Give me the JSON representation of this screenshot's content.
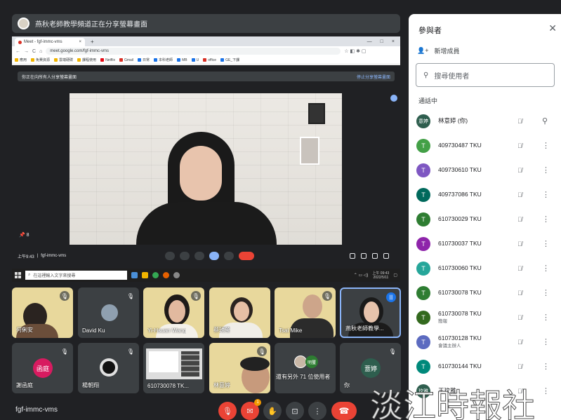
{
  "presenting_banner": "燕秋老師教學頻道正在分享螢幕畫面",
  "shared_screen": {
    "tab_title": "Meet - fgf-immc-vms",
    "tab_close": "×",
    "new_tab": "+",
    "window_controls": [
      "—",
      "□",
      "×"
    ],
    "url": "meet.google.com/fgf-immc-vms",
    "bookmarks": [
      "應用",
      "免費資源",
      "雲端硬碟",
      "課程使用",
      "Netflix",
      "Gmail",
      "日常",
      "本科老師",
      "MB",
      "U",
      "office",
      "GE_下課"
    ],
    "inner_banner": "你正在向所有人分享螢幕畫面",
    "inner_stop": "停止分享螢幕畫面",
    "inner_pin_count": "8",
    "inner_time": "上午9:43",
    "inner_code": "fgf-immc-vms",
    "taskbar_search": "在這裡輸入文字來搜尋",
    "taskbar_time": "上午 09:43",
    "taskbar_date": "2022/5/11"
  },
  "tiles": [
    {
      "name": "何俐安"
    },
    {
      "name": "David Ku"
    },
    {
      "name": "Yi-Hsuan Wang"
    },
    {
      "name": "蔡琇瑩"
    },
    {
      "name": "Tsai Mike"
    },
    {
      "name": "燕秋老師教學..."
    },
    {
      "name": "謝函庭",
      "avatar": "函庭"
    },
    {
      "name": "楊朝翔"
    },
    {
      "name": "610730078 TK..."
    },
    {
      "name": "林意婷"
    },
    {
      "name": "還有另外 71 位使用者",
      "avatar": "明璽"
    },
    {
      "name": "你",
      "avatar": "薏婷"
    }
  ],
  "bottom": {
    "meeting_code": "fgf-immc-vms",
    "notification_count": "1"
  },
  "panel": {
    "title": "參與者",
    "add_people": "新增成員",
    "search_placeholder": "搜尋使用者",
    "section": "通話中",
    "people": [
      {
        "name": "林意婷 (你)",
        "avatar": "意婷",
        "color": "#2e5e4e",
        "sub": ""
      },
      {
        "name": "409730487 TKU",
        "avatar": "T",
        "color": "#43a047",
        "sub": ""
      },
      {
        "name": "409730610 TKU",
        "avatar": "T",
        "color": "#7e57c2",
        "sub": ""
      },
      {
        "name": "409737086 TKU",
        "avatar": "T",
        "color": "#00695c",
        "sub": ""
      },
      {
        "name": "610730029 TKU",
        "avatar": "T",
        "color": "#2e7d32",
        "sub": ""
      },
      {
        "name": "610730037 TKU",
        "avatar": "T",
        "color": "#8e24aa",
        "sub": ""
      },
      {
        "name": "610730060 TKU",
        "avatar": "T",
        "color": "#26a69a",
        "sub": ""
      },
      {
        "name": "610730078 TKU",
        "avatar": "T",
        "color": "#2e7d32",
        "sub": ""
      },
      {
        "name": "610730078 TKU",
        "avatar": "T",
        "color": "#33691e",
        "sub": "簡報"
      },
      {
        "name": "610730128 TKU",
        "avatar": "T",
        "color": "#5c6bc0",
        "sub": "會議主辦人"
      },
      {
        "name": "610730144 TKU",
        "avatar": "T",
        "color": "#00897b",
        "sub": ""
      },
      {
        "name": "王玟雅",
        "avatar": "玟雅",
        "color": "#2e5e4e",
        "sub": ""
      }
    ]
  },
  "watermark": "淡江時報社",
  "colors": {
    "meet_bg": "#202124",
    "hangup": "#ea4335",
    "accent": "#8ab4f8"
  }
}
